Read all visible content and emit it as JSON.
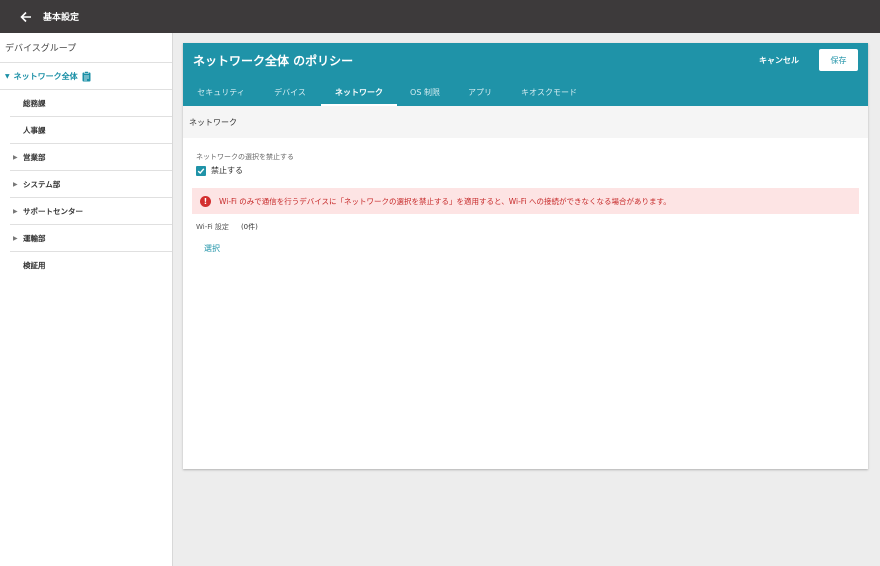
{
  "topbar": {
    "title": "基本設定",
    "back_icon": "arrow-left-icon"
  },
  "sidebar": {
    "header": "デバイスグループ",
    "root": {
      "label": "ネットワーク全体",
      "icon": "clipboard-icon",
      "color": "#1a8fa6"
    },
    "items": [
      {
        "label": "総務課",
        "expandable": false
      },
      {
        "label": "人事課",
        "expandable": false
      },
      {
        "label": "営業部",
        "expandable": true
      },
      {
        "label": "システム部",
        "expandable": true
      },
      {
        "label": "サポートセンター",
        "expandable": true
      },
      {
        "label": "運輸部",
        "expandable": true
      },
      {
        "label": "検証用",
        "expandable": false
      }
    ]
  },
  "policy": {
    "title": "ネットワーク全体 のポリシー",
    "cancel_label": "キャンセル",
    "save_label": "保存",
    "header_color": "#1f93a8",
    "tabs": [
      {
        "label": "セキュリティ",
        "active": false
      },
      {
        "label": "デバイス",
        "active": false
      },
      {
        "label": "ネットワーク",
        "active": true
      },
      {
        "label": "OS 制限",
        "active": false
      },
      {
        "label": "アプリ",
        "active": false
      },
      {
        "label": "キオスクモード",
        "active": false
      }
    ]
  },
  "network": {
    "section_title": "ネットワーク",
    "prohibit_label": "ネットワークの選択を禁止する",
    "prohibit_checkbox_label": "禁止する",
    "prohibit_checked": true,
    "alert_text": "Wi-Fi のみで通信を行うデバイスに「ネットワークの選択を禁止する」を適用すると、Wi-Fi への接続ができなくなる場合があります。",
    "alert_color": "#c62828",
    "wifi_label": "Wi-Fi 設定",
    "wifi_count": "(0件)",
    "select_link": "選択"
  }
}
